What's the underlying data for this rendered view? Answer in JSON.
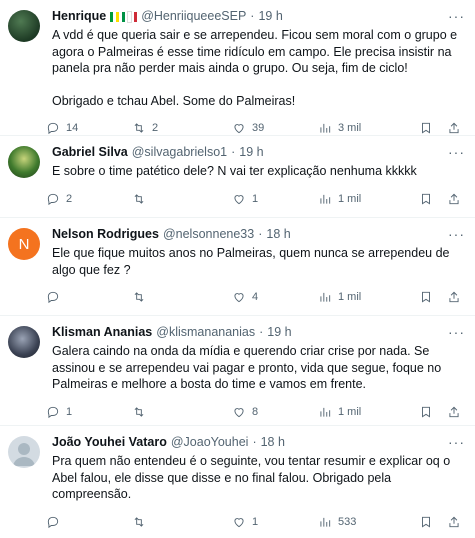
{
  "tweets": [
    {
      "name": "Henrique",
      "flags": "🇧🇷🇮🇹",
      "handle": "@HenriiqueeeSEP",
      "time": "19 h",
      "text_paragraphs": [
        "A vdd é que queria sair e se arrependeu. Ficou sem moral com o grupo e agora o Palmeiras é esse time ridículo em campo. Ele precisa insistir na panela pra não perder mais ainda o grupo. Ou seja, fim de ciclo!",
        "Obrigado e tchau Abel. Some do Palmeiras!"
      ],
      "replies": "14",
      "retweets": "2",
      "likes": "39",
      "views": "3 mil"
    },
    {
      "name": "Gabriel Silva",
      "handle": "@silvagabrielso1",
      "time": "19 h",
      "text_paragraphs": [
        "E sobre o time patético dele? N vai ter explicação nenhuma kkkkk"
      ],
      "replies": "2",
      "retweets": "",
      "likes": "1",
      "views": "1 mil"
    },
    {
      "name": "Nelson Rodrigues",
      "avatar_letter": "N",
      "handle": "@nelsonnene33",
      "time": "18 h",
      "text_paragraphs": [
        "Ele que fique muitos anos no Palmeiras, quem nunca se arrependeu de algo que fez ?"
      ],
      "replies": "",
      "retweets": "",
      "likes": "4",
      "views": "1 mil"
    },
    {
      "name": "Klisman Ananias",
      "handle": "@klismanananias",
      "time": "19 h",
      "text_paragraphs": [
        "Galera caindo na onda da mídia e querendo criar crise por nada. Se assinou e se arrependeu vai pagar e pronto, vida que segue, foque no Palmeiras e melhore a bosta do time e vamos em frente."
      ],
      "replies": "1",
      "retweets": "",
      "likes": "8",
      "views": "1 mil"
    },
    {
      "name": "João Youhei Vataro",
      "handle": "@JoaoYouhei",
      "time": "18 h",
      "text_paragraphs": [
        "Pra quem não entendeu é o seguinte, vou tentar resumir e explicar oq o Abel falou, ele disse que disse e no final falou. Obrigado pela compreensão."
      ],
      "replies": "",
      "retweets": "",
      "likes": "1",
      "views": "533"
    }
  ],
  "separator_dot": "·",
  "more_label": "···",
  "icons": {
    "reply": "reply-icon",
    "retweet": "retweet-icon",
    "like": "like-icon",
    "views": "views-icon",
    "bookmark": "bookmark-icon",
    "share": "share-icon"
  }
}
